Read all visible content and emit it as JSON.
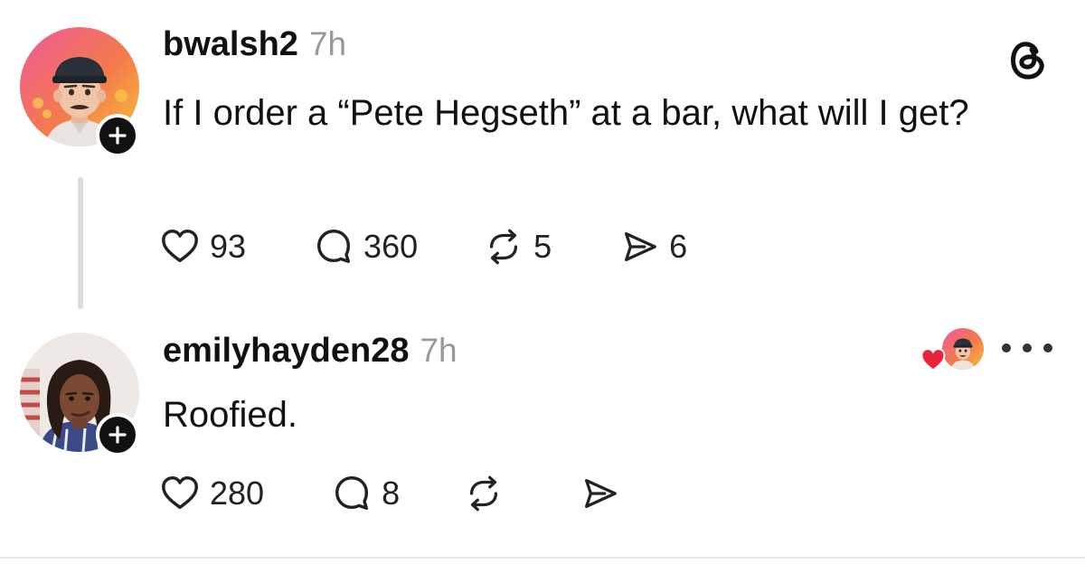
{
  "posts": [
    {
      "username": "bwalsh2",
      "time": "7h",
      "text": "If I order a “Pete Hegseth” at a bar, what will I get?",
      "avatar_icon": "memoji-avatar-icon",
      "actions": {
        "likes": "93",
        "replies": "360",
        "reposts": "5",
        "shares": "6"
      }
    },
    {
      "username": "emilyhayden28",
      "time": "7h",
      "text": "Roofied.",
      "avatar_icon": "profile-photo-avatar",
      "liked_by_author": true,
      "actions": {
        "likes": "280",
        "replies": "8",
        "reposts": "",
        "shares": ""
      }
    }
  ],
  "icons": {
    "app_logo": "threads-logo-icon",
    "like": "heart-icon",
    "reply": "comment-bubble-icon",
    "repost": "repost-icon",
    "share": "share-send-icon",
    "follow": "plus-icon",
    "more": "more-dots-icon"
  },
  "colors": {
    "text": "#111111",
    "muted": "#999999",
    "liked_heart": "#e8243c",
    "thread_line": "#dddddd",
    "avatar_gradient_start": "#f0608a",
    "avatar_gradient_end": "#f6b23a"
  }
}
